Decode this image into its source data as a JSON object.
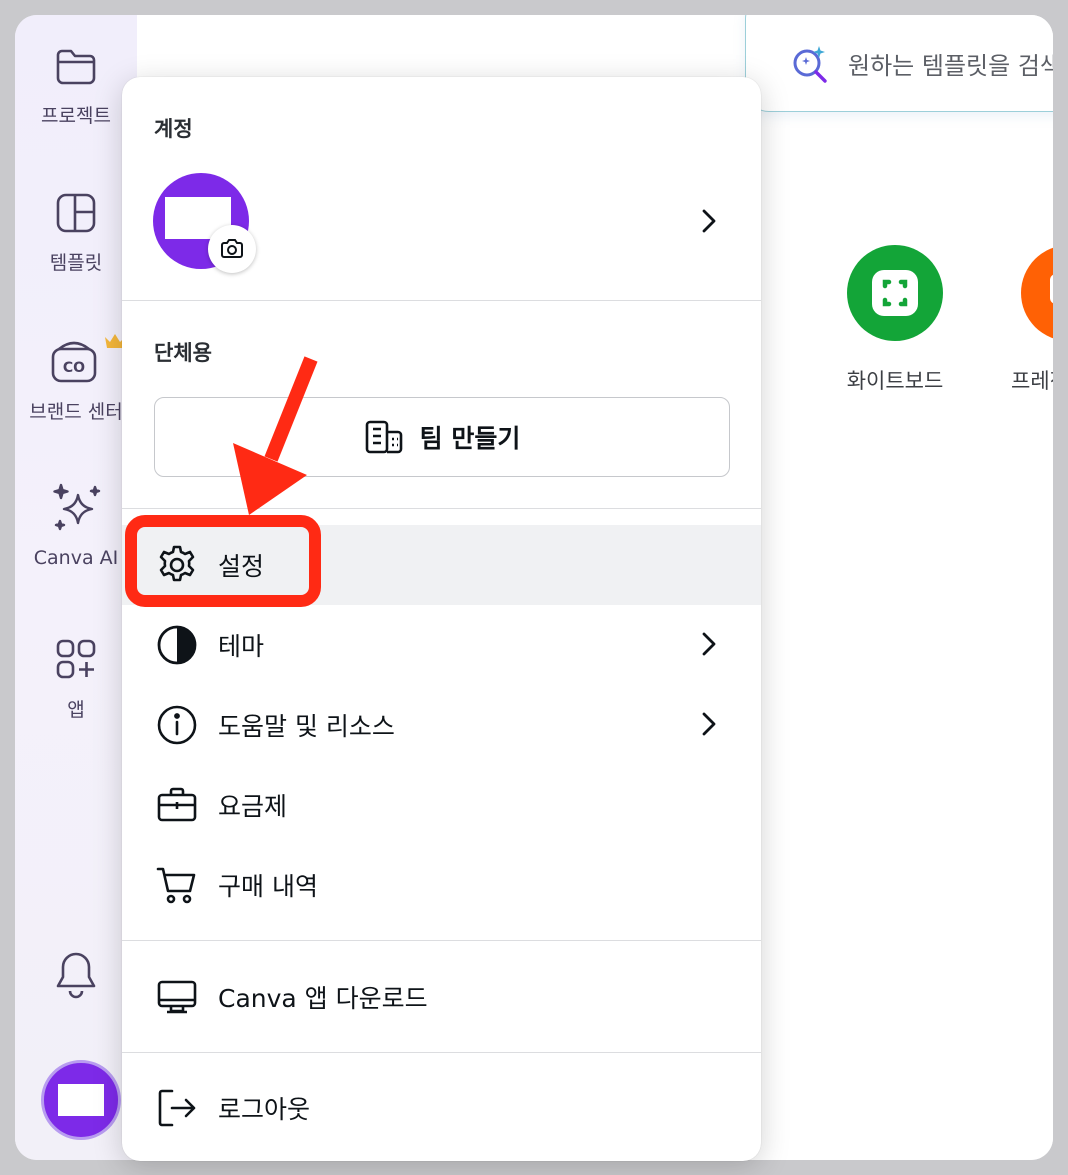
{
  "sidebar": {
    "items": [
      {
        "label": "프로젝트",
        "icon": "folder-icon"
      },
      {
        "label": "템플릿",
        "icon": "template-icon"
      },
      {
        "label": "브랜드 센터",
        "icon": "brand-center-icon"
      },
      {
        "label": "Canva AI",
        "icon": "sparkle-icon"
      },
      {
        "label": "앱",
        "icon": "apps-icon"
      }
    ],
    "notifications_icon": "bell-icon"
  },
  "search": {
    "placeholder": "원하는 템플릿을 검색"
  },
  "shortcuts": [
    {
      "label": "화이트보드",
      "color": "#13a538"
    },
    {
      "label": "프레젠테이션",
      "color": "#ff6105"
    }
  ],
  "account_menu": {
    "account_title": "계정",
    "team_title": "단체용",
    "team_button_label": "팀 만들기",
    "items": {
      "settings": "설정",
      "theme": "테마",
      "help": "도움말 및 리소스",
      "pricing": "요금제",
      "purchase_history": "구매 내역",
      "download_app": "Canva 앱 다운로드",
      "logout": "로그아웃"
    }
  },
  "colors": {
    "brand_purple": "#7d2ae8",
    "annotation_red": "#ff2a14",
    "crown_gold": "#f5b73b"
  }
}
